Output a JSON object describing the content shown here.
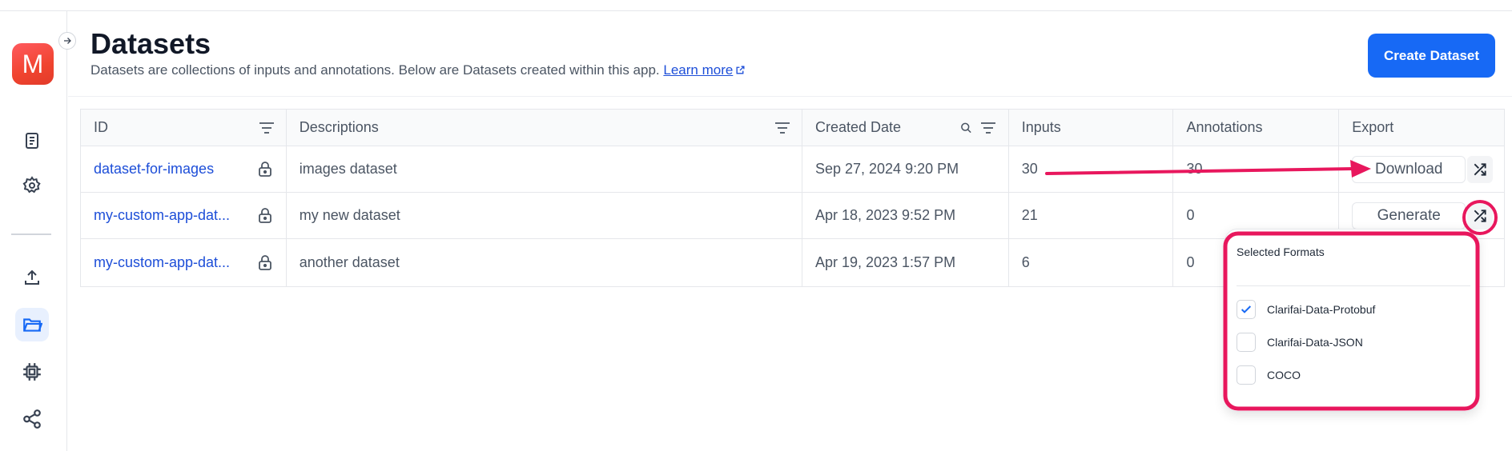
{
  "app": {
    "avatar_letter": "M"
  },
  "sidebar": {
    "items": [
      {
        "icon": "document-icon"
      },
      {
        "icon": "gear-icon"
      },
      {
        "icon": "upload-icon"
      },
      {
        "icon": "folder-icon",
        "active": true
      },
      {
        "icon": "chip-icon"
      },
      {
        "icon": "share-icon"
      }
    ]
  },
  "header": {
    "title": "Datasets",
    "subtitle": "Datasets are collections of inputs and annotations. Below are Datasets created within this app.",
    "learn_more": "Learn more",
    "create_button": "Create Dataset"
  },
  "table": {
    "columns": [
      "ID",
      "Descriptions",
      "Created Date",
      "Inputs",
      "Annotations",
      "Export"
    ],
    "rows": [
      {
        "id": "dataset-for-images",
        "description": "images dataset",
        "created": "Sep 27, 2024 9:20 PM",
        "inputs": "30",
        "annotations": "30",
        "export_label": "Download"
      },
      {
        "id": "my-custom-app-dat...",
        "description": "my new dataset",
        "created": "Apr 18, 2023 9:52 PM",
        "inputs": "21",
        "annotations": "0",
        "export_label": "Generate"
      },
      {
        "id": "my-custom-app-dat...",
        "description": "another dataset",
        "created": "Apr 19, 2023 1:57 PM",
        "inputs": "6",
        "annotations": "0",
        "export_label": ""
      }
    ]
  },
  "format_dropdown": {
    "title": "Selected Formats",
    "options": [
      {
        "label": "Clarifai-Data-Protobuf",
        "checked": true
      },
      {
        "label": "Clarifai-Data-JSON",
        "checked": false
      },
      {
        "label": "COCO",
        "checked": false
      }
    ]
  },
  "colors": {
    "accent": "#1769f5",
    "link": "#1d4ed8",
    "annotation": "#e8175d"
  }
}
